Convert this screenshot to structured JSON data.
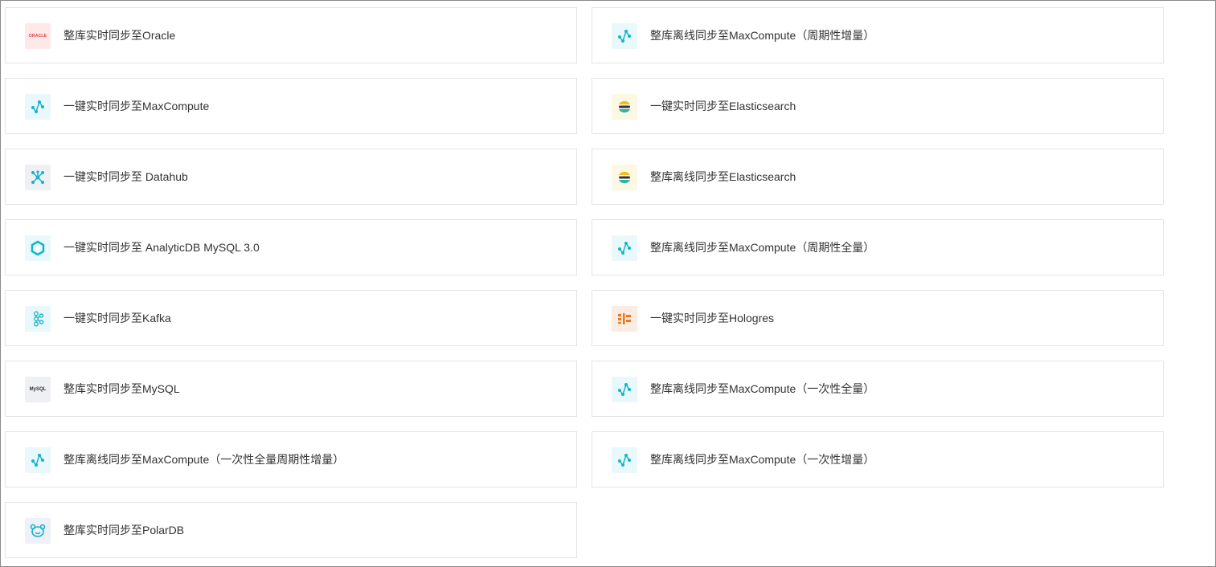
{
  "colors": {
    "accent_cyan": "#14b4cc",
    "oracle_red": "#e03b3b",
    "hologres_orange": "#f0751e",
    "card_border": "#e4e4e4"
  },
  "icon_texts": {
    "oracle": "ORACLE",
    "mysql": "MySQL"
  },
  "left_column": [
    {
      "icon": "oracle-icon",
      "label": "整库实时同步至Oracle"
    },
    {
      "icon": "maxcompute-icon",
      "label": "一键实时同步至MaxCompute"
    },
    {
      "icon": "datahub-icon",
      "label": "一键实时同步至 Datahub"
    },
    {
      "icon": "analyticdb-icon",
      "label": "一键实时同步至 AnalyticDB MySQL 3.0"
    },
    {
      "icon": "kafka-icon",
      "label": "一键实时同步至Kafka"
    },
    {
      "icon": "mysql-icon",
      "label": "整库实时同步至MySQL"
    },
    {
      "icon": "maxcompute-icon",
      "label": "整库离线同步至MaxCompute（一次性全量周期性增量）"
    },
    {
      "icon": "polardb-icon",
      "label": "整库实时同步至PolarDB"
    }
  ],
  "right_column": [
    {
      "icon": "maxcompute-icon",
      "label": "整库离线同步至MaxCompute（周期性增量）"
    },
    {
      "icon": "elasticsearch-icon",
      "label": "一键实时同步至Elasticsearch"
    },
    {
      "icon": "elasticsearch-icon",
      "label": "整库离线同步至Elasticsearch"
    },
    {
      "icon": "maxcompute-icon",
      "label": "整库离线同步至MaxCompute（周期性全量）"
    },
    {
      "icon": "hologres-icon",
      "label": "一键实时同步至Hologres"
    },
    {
      "icon": "maxcompute-icon",
      "label": "整库离线同步至MaxCompute（一次性全量）"
    },
    {
      "icon": "maxcompute-icon",
      "label": "整库离线同步至MaxCompute（一次性增量）"
    }
  ]
}
